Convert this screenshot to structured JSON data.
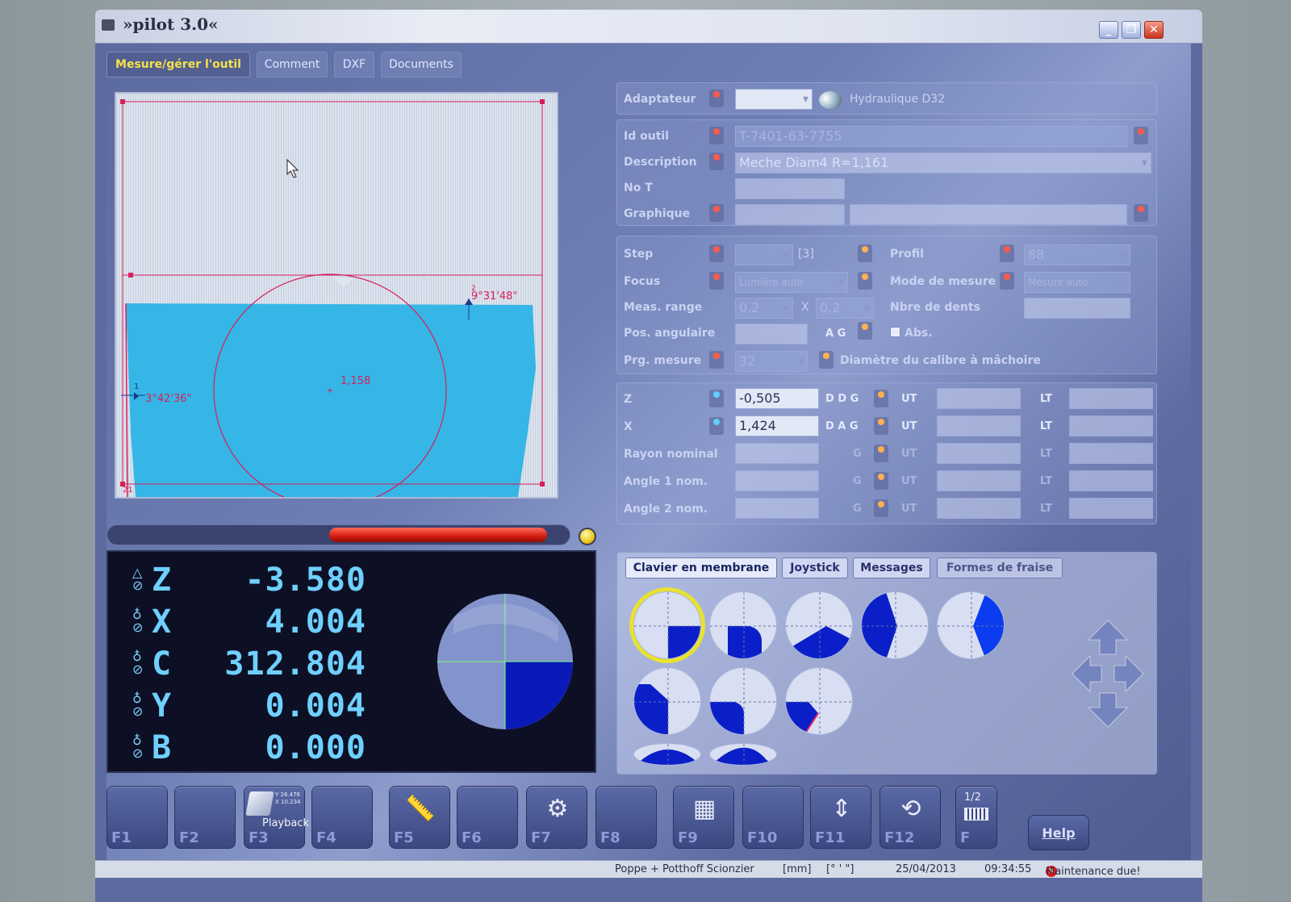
{
  "window": {
    "title": "»pilot 3.0«",
    "min_label": "_",
    "max_label": "❐",
    "close_label": "✕"
  },
  "tabs": [
    {
      "label": "Mesure/gérer l'outil"
    },
    {
      "label": "Comment"
    },
    {
      "label": "DXF"
    },
    {
      "label": "Documents"
    }
  ],
  "viewport": {
    "angle_right": "9°31'48\"",
    "angle_left": "3°42'36\"",
    "radius": "1,158",
    "marker_2": "2",
    "marker_1": "1",
    "marker_21": "21"
  },
  "gauge": {
    "fill_fraction": 0.47,
    "lamp_color": "#e9c81a"
  },
  "dro": {
    "axes": [
      {
        "axis": "Z",
        "value": "-3.580"
      },
      {
        "axis": "X",
        "value": "4.004"
      },
      {
        "axis": "C",
        "value": "312.804"
      },
      {
        "axis": "Y",
        "value": "0.004"
      },
      {
        "axis": "B",
        "value": "0.000"
      }
    ]
  },
  "form": {
    "adaptateur": {
      "label": "Adaptateur",
      "value": "",
      "info": "Hydraulique D32"
    },
    "id_outil": {
      "label": "Id outil",
      "value": "T-7401-63-7755"
    },
    "description": {
      "label": "Description",
      "value": "Meche Diam4  R=1,161"
    },
    "no_t": {
      "label": "No T",
      "value": ""
    },
    "graphique": {
      "label": "Graphique",
      "value": ""
    },
    "step": {
      "label": "Step",
      "value": "",
      "suffix": "[3]"
    },
    "profil": {
      "label": "Profil",
      "value": "88"
    },
    "focus": {
      "label": "Focus",
      "value": "Lumière auto"
    },
    "mode_mesure": {
      "label": "Mode de mesure",
      "value": "Mesure auto"
    },
    "meas_range": {
      "label": "Meas. range",
      "value1": "0,2",
      "sep": "X",
      "value2": "0,2"
    },
    "nbre_dents": {
      "label": "Nbre de dents",
      "value": ""
    },
    "pos_angulaire": {
      "label": "Pos. angulaire",
      "value": "",
      "ag": "A G",
      "abs": "Abs."
    },
    "prg_mesure": {
      "label": "Prg. mesure",
      "value": "32",
      "calibre": "Diamètre du calibre à mâchoire"
    },
    "z": {
      "label": "Z",
      "value": "-0,505",
      "code": "D D G",
      "ut": "UT",
      "lt": "LT"
    },
    "x": {
      "label": "X",
      "value": "1,424",
      "code": "D A G",
      "ut": "UT",
      "lt": "LT"
    },
    "rayon": {
      "label": "Rayon nominal",
      "code": "G",
      "ut": "UT",
      "lt": "LT"
    },
    "angle1": {
      "label": "Angle 1 nom.",
      "code": "G",
      "ut": "UT",
      "lt": "LT"
    },
    "angle2": {
      "label": "Angle 2 nom.",
      "code": "G",
      "ut": "UT",
      "lt": "LT"
    }
  },
  "shape_tabs": [
    {
      "label": "Clavier en membrane"
    },
    {
      "label": "Joystick"
    },
    {
      "label": "Messages"
    },
    {
      "label": "Formes de fraise"
    }
  ],
  "fkeys": [
    {
      "label": "F1",
      "icon": ""
    },
    {
      "label": "F2",
      "icon": ""
    },
    {
      "label": "F3",
      "icon": "playback-icon",
      "caption": "Playback",
      "coords": "Y 26.476 X 10.234"
    },
    {
      "label": "F4",
      "icon": ""
    },
    {
      "label": "F5",
      "icon": "caliper-icon"
    },
    {
      "label": "F6",
      "icon": ""
    },
    {
      "label": "F7",
      "icon": "tool-holder-icon"
    },
    {
      "label": "F8",
      "icon": ""
    },
    {
      "label": "F9",
      "icon": "tool-list-add-icon"
    },
    {
      "label": "F10",
      "icon": ""
    },
    {
      "label": "F11",
      "icon": "axis-move-icon"
    },
    {
      "label": "F12",
      "icon": "tool-rotate-icon"
    },
    {
      "label": "F",
      "icon": "keyboard-icon",
      "page": "1/2"
    }
  ],
  "help_label": "Help",
  "status": {
    "company": "Poppe + Potthoff Scionzier",
    "unit": "[mm]",
    "angle_unit": "[° ' \"]",
    "date": "25/04/2013",
    "time": "09:34:55",
    "maintenance": "Maintenance due!"
  },
  "colors": {
    "accent": "#f5e24a",
    "tool_fill": "#35b6e6",
    "contour": "#d81e5b",
    "dro_text": "#6fd0ff",
    "shape_blue": "#0b1fc8"
  }
}
